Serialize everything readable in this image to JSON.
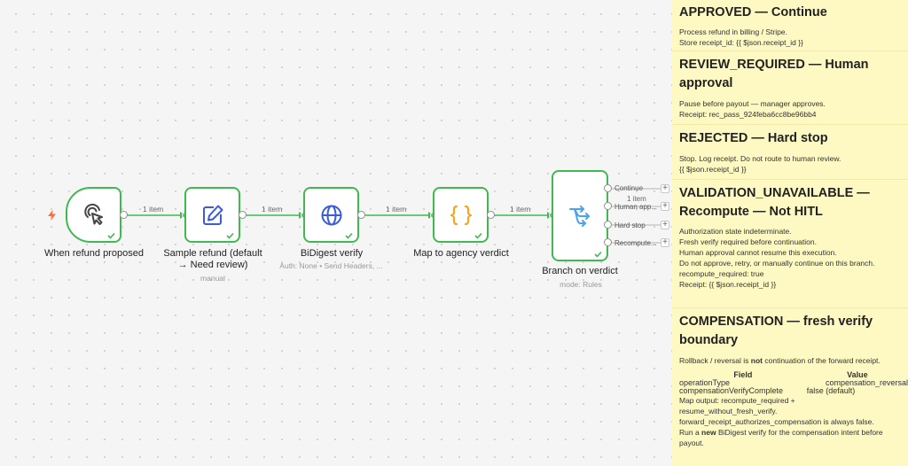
{
  "colors": {
    "accent_green": "#3fb950",
    "note_bg": "#fef9c3",
    "trigger_orange": "#ff6d3a",
    "globe_blue": "#3b5bdb",
    "braces_orange": "#f5a623",
    "switch_blue": "#4aa3f0"
  },
  "nodes": [
    {
      "name": "When refund proposed",
      "icon": "pointer-click-icon"
    },
    {
      "name_line1": "Sample refund (default",
      "name_line2": "→ Need review)",
      "subtitle": "manual",
      "icon": "edit-icon"
    },
    {
      "name": "BiDigest verify",
      "subtitle": "Auth: None • Send Headers, ...",
      "icon": "globe-icon"
    },
    {
      "name": "Map to agency verdict",
      "icon": "braces-icon"
    },
    {
      "name": "Branch on verdict",
      "subtitle": "mode: Rules",
      "icon": "switch-icon"
    }
  ],
  "connections": [
    "1 item",
    "1 item",
    "1 item",
    "1 item"
  ],
  "branches": [
    {
      "label": "Continue"
    },
    {
      "label": "Human app...",
      "count": "1 item"
    },
    {
      "label": "Hard stop"
    },
    {
      "label": "Recompute..."
    }
  ],
  "sticky_notes": {
    "approved": {
      "title": "APPROVED — Continue",
      "lines": [
        "Process refund in billing / Stripe.",
        "Store receipt_id: {{ $json.receipt_id }}"
      ]
    },
    "review": {
      "title_line1": "REVIEW_REQUIRED — Human",
      "title_line2": "approval",
      "lines": [
        "Pause before payout — manager approves.",
        "Receipt: rec_pass_924feba6cc8be96bb4"
      ]
    },
    "rejected": {
      "title": "REJECTED — Hard stop",
      "lines": [
        "Stop. Log receipt. Do not route to human review.",
        "{{ $json.receipt_id }}"
      ]
    },
    "validation": {
      "title_line1": "VALIDATION_UNAVAILABLE —",
      "title_line2": "Recompute — Not HITL",
      "lines": [
        "Authorization state indeterminate.",
        "Fresh verify required before continuation.",
        "Human approval cannot resume this execution.",
        "Do not approve, retry, or manually continue on this branch.",
        "recompute_required: true",
        "Receipt: {{ $json.receipt_id }}"
      ]
    },
    "compensation": {
      "title_line1": "COMPENSATION — fresh verify",
      "title_line2": "boundary",
      "intro_pre": "Rollback / reversal is ",
      "intro_bold": "not",
      "intro_post": " continuation of the forward receipt.",
      "table": {
        "headers": [
          "Field",
          "Value"
        ],
        "rows": [
          [
            "operationType",
            "compensation_reversal"
          ],
          [
            "compensationVerifyComplete",
            "false (default)"
          ]
        ]
      },
      "lines": [
        "Map output: recompute_required +",
        "resume_without_fresh_verify.",
        "forward_receipt_authorizes_compensation is always false."
      ],
      "last_pre": "Run a ",
      "last_bold": "new",
      "last_post": " BiDigest verify for the compensation intent before payout."
    }
  }
}
